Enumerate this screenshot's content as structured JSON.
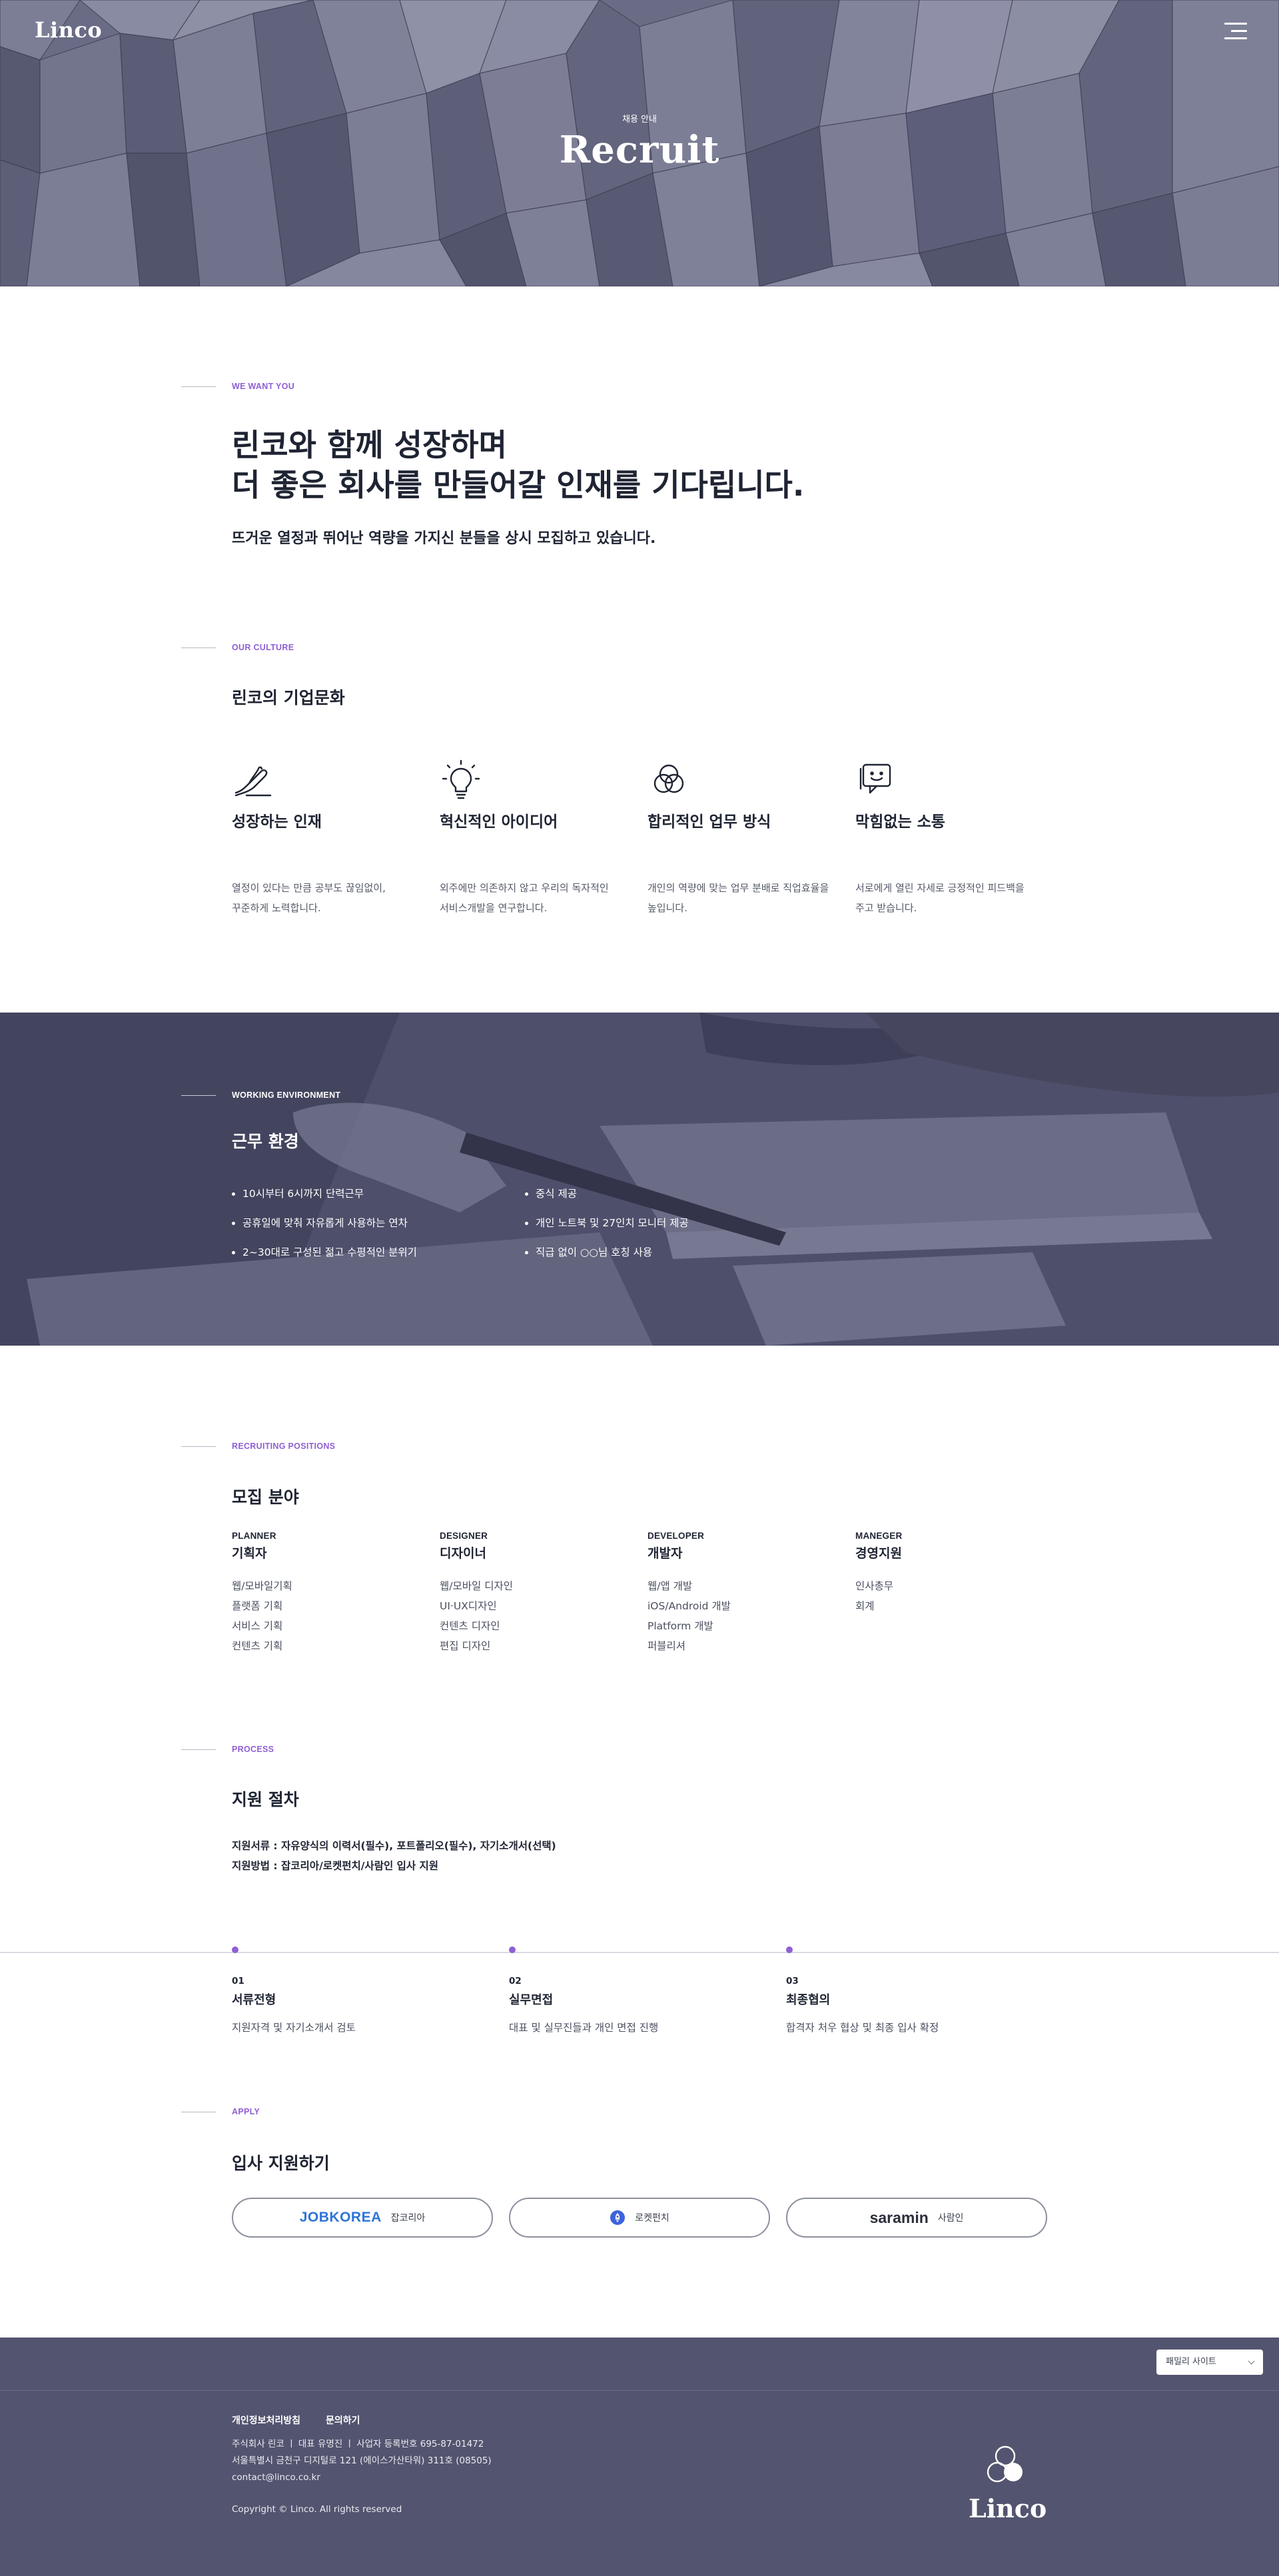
{
  "header": {
    "logo": "Linco",
    "menu_icon": "hamburger-menu-icon",
    "eyebrow": "채용 안내",
    "title": "Recruit"
  },
  "want": {
    "label": "WE WANT YOU",
    "heading_line1": "린코와 함께 성장하며",
    "heading_line2": "더 좋은 회사를 만들어갈 인재를 기다립니다.",
    "subtext": "뜨거운 열정과 뛰어난 역량을 가지신 분들을 상시 모집하고 있습니다."
  },
  "culture": {
    "label": "OUR CULTURE",
    "title": "린코의 기업문화",
    "items": [
      {
        "icon": "writing-hand-icon",
        "title": "성장하는 인재",
        "line1": "열정이 있다는 만큼 공부도 끊임없이,",
        "line2": "꾸준하게 노력합니다."
      },
      {
        "icon": "lightbulb-icon",
        "title": "혁신적인 아이디어",
        "line1": "외주에만 의존하지 않고 우리의 독자적인",
        "line2": "서비스개발을 연구합니다."
      },
      {
        "icon": "venn-circles-icon",
        "title": "합리적인 업무 방식",
        "line1": "개인의 역량에 맞는 업무 분배로 직업효율을",
        "line2": "높입니다."
      },
      {
        "icon": "chat-smile-icon",
        "title": "막힘없는 소통",
        "line1": "서로에게 열린 자세로 긍정적인 피드백을",
        "line2": "주고 받습니다."
      }
    ]
  },
  "environment": {
    "label": "WORKING ENVIRONMENT",
    "title": "근무 환경",
    "col1": [
      "10시부터 6시까지 단력근무",
      "공휴일에 맞춰 자유롭게 사용하는 연차",
      "2~30대로 구성된 젊고 수평적인 분위기"
    ],
    "col2": [
      "중식 제공",
      "개인 노트북 및 27인치 모니터 제공",
      "직급 없이 ○○님 호칭 사용"
    ]
  },
  "positions": {
    "label": "RECRUITING POSITIONS",
    "title": "모집 분야",
    "items": [
      {
        "en": "PLANNER",
        "ko": "기획자",
        "list": [
          "웹/모바일기획",
          "플랫폼 기획",
          "서비스 기획",
          "컨텐츠 기획"
        ]
      },
      {
        "en": "DESIGNER",
        "ko": "디자이너",
        "list": [
          "웹/모바일 디자인",
          "UI·UX디자인",
          "컨텐츠 디자인",
          "편집 디자인"
        ]
      },
      {
        "en": "DEVELOPER",
        "ko": "개발자",
        "list": [
          "웹/앱 개발",
          "iOS/Android 개발",
          "Platform 개발",
          "퍼블리셔"
        ]
      },
      {
        "en": "MANEGER",
        "ko": "경영지원",
        "list": [
          "인사총무",
          "회계"
        ]
      }
    ]
  },
  "process": {
    "label": "PROCESS",
    "title": "지원 절차",
    "docs": "지원서류 : 자유양식의 이력서(필수), 포트폴리오(필수), 자기소개서(선택)",
    "method": "지원방법 : 잡코리아/로켓펀치/사람인 입사 지원",
    "steps": [
      {
        "num": "01",
        "title": "서류전형",
        "desc": "지원자격 및 자기소개서 검토"
      },
      {
        "num": "02",
        "title": "실무면접",
        "desc": "대표 및 실무진들과 개인 면접 진행"
      },
      {
        "num": "03",
        "title": "최종협의",
        "desc": "합격자 처우 협상 및 최종 입사 확정"
      }
    ]
  },
  "apply": {
    "label": "APPLY",
    "title": "입사 지원하기",
    "buttons": [
      {
        "brand": "JOBKOREA",
        "ko": "잡코리아",
        "color": "#2e74d9"
      },
      {
        "brand": "",
        "ko": "로켓펀치",
        "color": "#3d63dd",
        "icon": "rocketpunch-logo-icon"
      },
      {
        "brand": "saramin",
        "ko": "사람인",
        "color": "#2b2f3a"
      }
    ]
  },
  "footer": {
    "family_site": "패밀리 사이트",
    "privacy": "개인정보처리방침",
    "contact": "문의하기",
    "info_line1": "주식회사 린코 ㅣ 대표 유명진 ㅣ 사업자 등록번호 695-87-01472",
    "info_line2": "서울특별시 금천구 디지털로 121 (에이스가산타워) 311호 (08505)",
    "email": "contact@linco.co.kr",
    "copyright": "Copyright © Linco. All rights reserved",
    "logo": "Linco"
  },
  "colors": {
    "accent": "#8f5fd4",
    "text": "#1f2433",
    "hero_tint": "#6e6f88",
    "footer_bg": "#53546f"
  }
}
